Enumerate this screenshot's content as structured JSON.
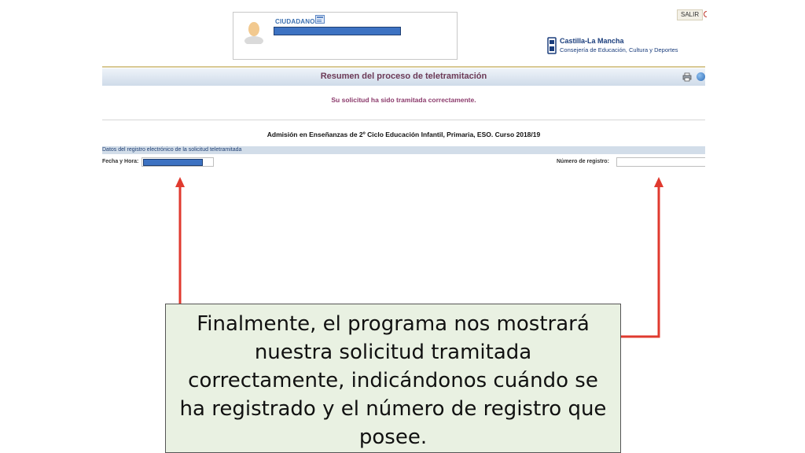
{
  "header": {
    "user_role": "CIUDADANO",
    "logout_label": "SALIR",
    "institution_name": "Castilla-La Mancha",
    "institution_department": "Consejería de Educación, Cultura y Deportes"
  },
  "summary": {
    "title": "Resumen del proceso de teletramitación",
    "status_message": "Su solicitud ha sido tramitada correctamente."
  },
  "procedure_title": "Admisión en Enseñanzas de 2º Ciclo Educación Infantil, Primaria, ESO. Curso 2018/19",
  "registration": {
    "section_title": "Datos del registro electrónico de la solicitud teletramitada",
    "date_label": "Fecha y Hora:",
    "number_label": "Número de registro:"
  },
  "callout": {
    "text": "Finalmente, el programa nos mostrará nuestra solicitud  tramitada correctamente, indicándonos cuándo se ha registrado y el número de registro que posee."
  },
  "colors": {
    "arrow": "#e03a2f",
    "accent_blue": "#3d72c2",
    "title_plum": "#6c3a57",
    "callout_bg": "#e9f1e2"
  }
}
